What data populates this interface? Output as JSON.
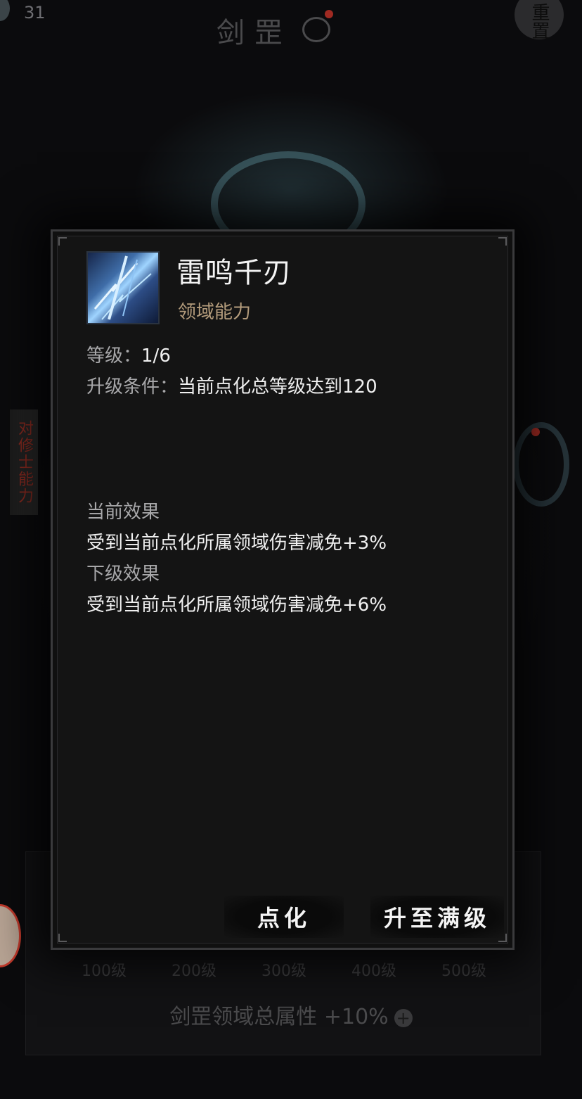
{
  "top_bar": {
    "level": "31",
    "title": "剑罡",
    "reset_label": "重置"
  },
  "side_tab_left": {
    "label": "对修士能力"
  },
  "progress": {
    "milestones": [
      "100级",
      "200级",
      "300级",
      "400级",
      "500级"
    ],
    "total_bonus": "剑罡领域总属性 +10%"
  },
  "popup": {
    "skill_name": "雷鸣千刃",
    "skill_type": "领域能力",
    "level_label": "等级：",
    "level_value": "1/6",
    "upgrade_label": "升级条件：",
    "upgrade_value": "当前点化总等级达到120",
    "current_effect_title": "当前效果",
    "current_effect_text": "受到当前点化所属领域伤害减免+3%",
    "next_effect_title": "下级效果",
    "next_effect_text": "受到当前点化所属领域伤害减免+6%",
    "buttons": {
      "refine": "点化",
      "max_level": "升至满级"
    }
  },
  "colors": {
    "background": "#0b0b0d",
    "popup_bg": "#141414",
    "skill_type": "#b49c7c",
    "muted_text": "#a8a8aa",
    "badge_red": "#a02a22"
  }
}
